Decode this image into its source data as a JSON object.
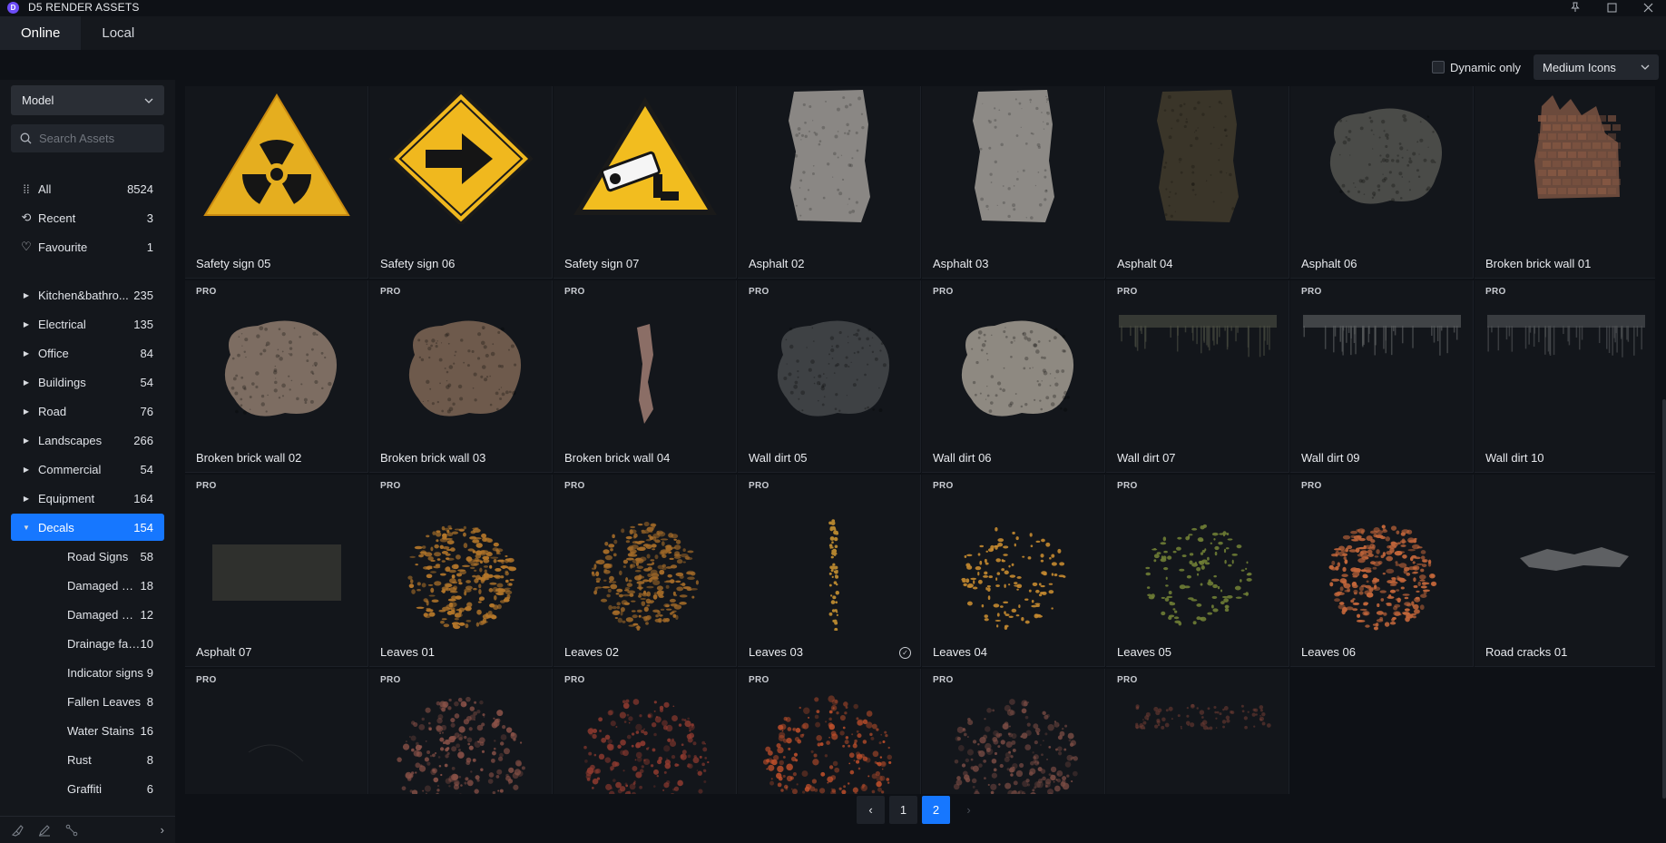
{
  "app": {
    "title": "D5 RENDER ASSETS",
    "logo_letter": "D"
  },
  "window_controls": {
    "pin": "⊿",
    "maximize": "☐",
    "close": "✕"
  },
  "tabs": [
    {
      "label": "Online",
      "active": true
    },
    {
      "label": "Local",
      "active": false
    }
  ],
  "filters": {
    "dynamic_only_label": "Dynamic only",
    "dynamic_only_checked": false,
    "view_mode": "Medium Icons"
  },
  "sidebar": {
    "model_select": "Model",
    "search_placeholder": "Search Assets",
    "quick": [
      {
        "icon": "grid-icon",
        "glyph": "⁞⁞",
        "label": "All",
        "count": "8524"
      },
      {
        "icon": "recent-icon",
        "glyph": "⟲",
        "label": "Recent",
        "count": "3"
      },
      {
        "icon": "heart-icon",
        "glyph": "♡",
        "label": "Favourite",
        "count": "1"
      }
    ],
    "categories": [
      {
        "label": "Kitchen&bathro...",
        "count": "235"
      },
      {
        "label": "Electrical",
        "count": "135"
      },
      {
        "label": "Office",
        "count": "84"
      },
      {
        "label": "Buildings",
        "count": "54"
      },
      {
        "label": "Road",
        "count": "76"
      },
      {
        "label": "Landscapes",
        "count": "266"
      },
      {
        "label": "Commercial",
        "count": "54"
      },
      {
        "label": "Equipment",
        "count": "164"
      },
      {
        "label": "Decals",
        "count": "154",
        "active": true
      }
    ],
    "subcategories": [
      {
        "label": "Road Signs",
        "count": "58"
      },
      {
        "label": "Damaged walls",
        "count": "18"
      },
      {
        "label": "Damaged Pave...",
        "count": "12"
      },
      {
        "label": "Drainage facilities",
        "count": "10"
      },
      {
        "label": "Indicator signs",
        "count": "9"
      },
      {
        "label": "Fallen Leaves",
        "count": "8"
      },
      {
        "label": "Water Stains",
        "count": "16"
      },
      {
        "label": "Rust",
        "count": "8"
      },
      {
        "label": "Graffiti",
        "count": "6"
      }
    ],
    "footer_icons": [
      "brush-icon",
      "pen-icon",
      "node-icon"
    ]
  },
  "assets": [
    {
      "name": "Safety sign 05",
      "pro": false,
      "thumb": "radiation"
    },
    {
      "name": "Safety sign 06",
      "pro": false,
      "thumb": "arrow"
    },
    {
      "name": "Safety sign 07",
      "pro": false,
      "thumb": "camera"
    },
    {
      "name": "Asphalt 02",
      "pro": false,
      "thumb": "patch",
      "color": "#8a8784"
    },
    {
      "name": "Asphalt 03",
      "pro": false,
      "thumb": "patch",
      "color": "#8d8a86"
    },
    {
      "name": "Asphalt 04",
      "pro": false,
      "thumb": "patch",
      "color": "#3a3529"
    },
    {
      "name": "Asphalt 06",
      "pro": false,
      "thumb": "blob",
      "color": "#4a4b48"
    },
    {
      "name": "Broken brick wall 01",
      "pro": false,
      "thumb": "brick",
      "color": "#6b4a3c"
    },
    {
      "name": "Broken brick wall 02",
      "pro": true,
      "thumb": "blob",
      "color": "#7d6d62"
    },
    {
      "name": "Broken brick wall 03",
      "pro": true,
      "thumb": "blob",
      "color": "#6e5a4c"
    },
    {
      "name": "Broken brick wall 04",
      "pro": true,
      "thumb": "strip",
      "color": "#8b6e66"
    },
    {
      "name": "Wall dirt 05",
      "pro": true,
      "thumb": "blob",
      "color": "#3e4144"
    },
    {
      "name": "Wall dirt 06",
      "pro": true,
      "thumb": "blob",
      "color": "#8e8981"
    },
    {
      "name": "Wall dirt 07",
      "pro": true,
      "thumb": "drip",
      "color": "#46493f"
    },
    {
      "name": "Wall dirt 09",
      "pro": true,
      "thumb": "drip",
      "color": "#55595a"
    },
    {
      "name": "Wall dirt 10",
      "pro": true,
      "thumb": "drip",
      "color": "#4a4d50"
    },
    {
      "name": "Asphalt 07",
      "pro": true,
      "thumb": "rect",
      "color": "#2f302d"
    },
    {
      "name": "Leaves 01",
      "pro": true,
      "thumb": "leaves",
      "color": "#b3762a"
    },
    {
      "name": "Leaves 02",
      "pro": true,
      "thumb": "leaves",
      "color": "#a26a28"
    },
    {
      "name": "Leaves 03",
      "pro": true,
      "thumb": "vstrip",
      "color": "#b3842f",
      "selected": true
    },
    {
      "name": "Leaves 04",
      "pro": true,
      "thumb": "scatter",
      "color": "#c58a30"
    },
    {
      "name": "Leaves 05",
      "pro": true,
      "thumb": "scatter",
      "color": "#6f7d35"
    },
    {
      "name": "Leaves 06",
      "pro": true,
      "thumb": "leaves",
      "color": "#c2663a"
    },
    {
      "name": "Road cracks 01",
      "pro": false,
      "thumb": "cracks",
      "color": "#5e6063"
    },
    {
      "name": "",
      "pro": true,
      "thumb": "faint",
      "color": "#1e2024"
    },
    {
      "name": "",
      "pro": true,
      "thumb": "rust",
      "color": "#8a5248"
    },
    {
      "name": "",
      "pro": true,
      "thumb": "rust",
      "color": "#8f3a2f"
    },
    {
      "name": "",
      "pro": true,
      "thumb": "rust",
      "color": "#c2502b"
    },
    {
      "name": "",
      "pro": true,
      "thumb": "rust",
      "color": "#7a4c44"
    },
    {
      "name": "",
      "pro": true,
      "thumb": "rusttop",
      "color": "#6b3b32"
    }
  ],
  "pagination": {
    "prev": "‹",
    "pages": [
      "1",
      "2"
    ],
    "current": "2",
    "next": "›"
  },
  "colors": {
    "accent": "#1677ff",
    "bg": "#0e1116",
    "card": "#13161b"
  }
}
